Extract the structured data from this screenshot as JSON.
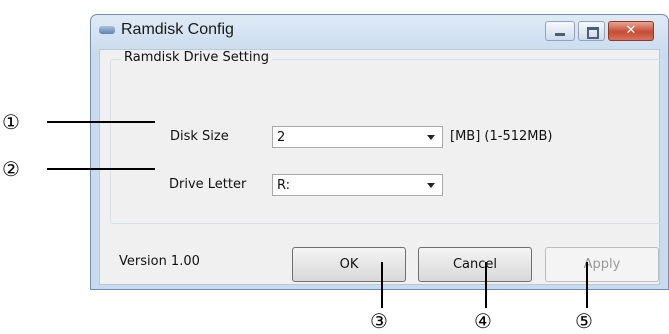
{
  "window": {
    "title": "Ramdisk Config",
    "caption_buttons": {
      "minimize_icon": "minimize-icon",
      "maximize_icon": "maximize-icon",
      "close_icon": "close-icon",
      "close_glyph": "✕"
    }
  },
  "group": {
    "label": "Ramdisk Drive Setting",
    "disk_size": {
      "label": "Disk Size",
      "value": "2",
      "unit_hint": "[MB] (1-512MB)"
    },
    "drive_letter": {
      "label": "Drive Letter",
      "value": "R:"
    }
  },
  "footer": {
    "version": "Version 1.00",
    "ok_label": "OK",
    "cancel_label": "Cancel",
    "apply_label": "Apply"
  },
  "callouts": [
    "①",
    "②",
    "③",
    "④",
    "⑤"
  ],
  "colors": {
    "close_button": "#c44d35",
    "titlebar": "#c9dbee",
    "dialog_bg": "#f0f0f0"
  }
}
